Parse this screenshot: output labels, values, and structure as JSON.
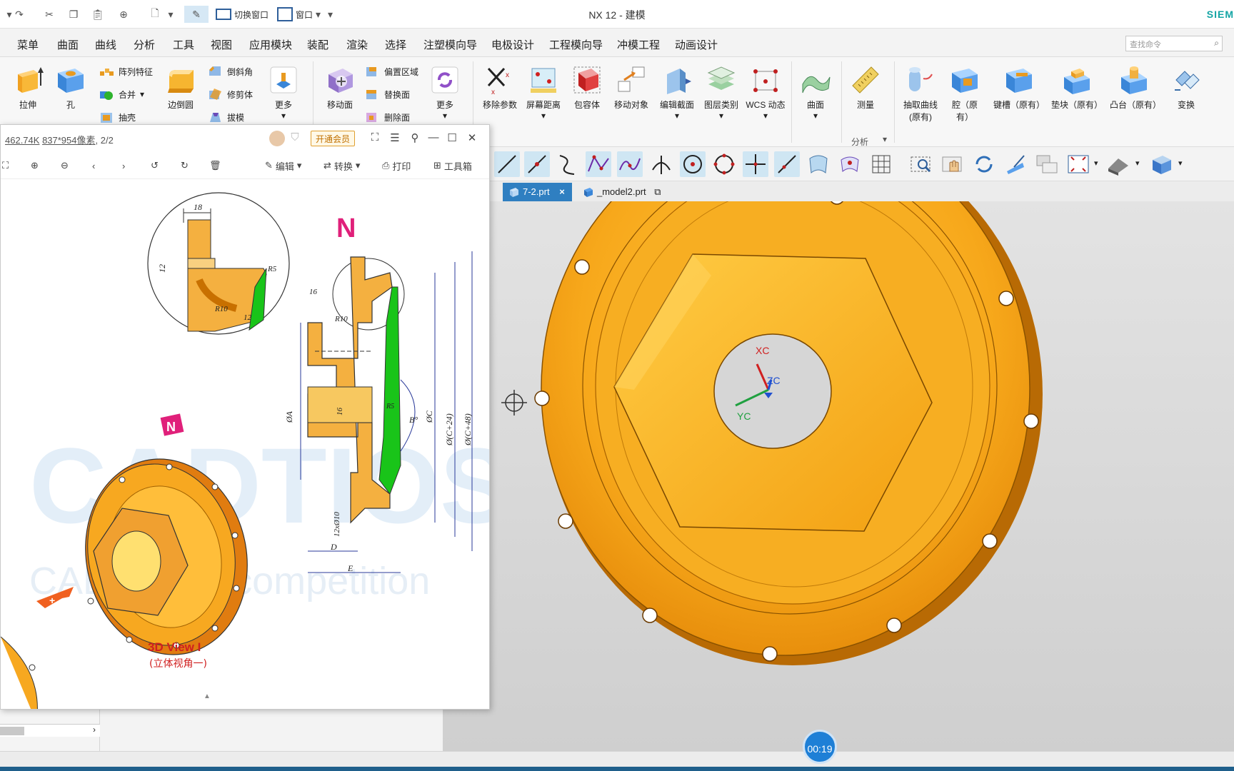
{
  "window": {
    "title": "NX 12 - 建模",
    "brand": "SIEM",
    "quick_access": {
      "switch_window": "切换窗口",
      "window": "窗口"
    }
  },
  "menu": {
    "items": [
      "菜单",
      "曲面",
      "曲线",
      "分析",
      "工具",
      "视图",
      "应用模块",
      "装配",
      "渲染",
      "选择",
      "注塑模向导",
      "电极设计",
      "工程模向导",
      "冲模工程",
      "动画设计"
    ],
    "search_placeholder": "查找命令"
  },
  "ribbon": {
    "extrude": "拉伸",
    "hole": "孔",
    "pattern_feature": "阵列特征",
    "unite": "合并",
    "shell": "抽壳",
    "edge_blend": "边倒圆",
    "chamfer": "倒斜角",
    "trim_body": "修剪体",
    "draft": "拔模",
    "more1": "更多",
    "move_face": "移动面",
    "offset_region": "偏置区域",
    "replace_face": "替换面",
    "delete_face": "删除面",
    "more2": "更多",
    "remove_params": "移除参数",
    "screen_distance": "屏幕距离",
    "bounding_body": "包容体",
    "move_object": "移动对象",
    "edit_section": "编辑截面",
    "layer_category": "图层类别",
    "wcs_dynamic": "WCS 动态",
    "surface": "曲面",
    "measure": "测量",
    "analysis_group": "分析",
    "extract_curve_line1": "抽取曲线",
    "extract_curve_line2": "(原有)",
    "cavity": "腔（原有）",
    "slot": "键槽（原有）",
    "pad": "垫块（原有）",
    "boss": "凸台（原有）",
    "transform": "变换"
  },
  "tabs": [
    {
      "label": "7-2.prt",
      "active": true,
      "close": "×"
    },
    {
      "label": "_model2.prt",
      "active": false
    }
  ],
  "viewer": {
    "file_size": "462.74K",
    "dimensions": "837*954像素",
    "page": ", 2/2",
    "vip": "开通会员",
    "toolbar": {
      "edit": "编辑",
      "convert": "转换",
      "print": "打印",
      "toolbox": "工具箱"
    },
    "drawing": {
      "marker": "N",
      "view_title": "3D View I",
      "view_subtitle": "(立体视角一)",
      "watermark_line1": "CADTIOS",
      "watermark_line2": "CAD digital competition",
      "dims": [
        "18",
        "12",
        "R5",
        "R10",
        "12",
        "16",
        "R10",
        "16",
        "ØA",
        "R5",
        "B°",
        "ØC",
        "Ø(C+24)",
        "Ø(C+48)",
        "12xØ10",
        "D",
        "E"
      ]
    }
  },
  "viewport": {
    "axes": {
      "x": "XC",
      "y": "YC",
      "z": "ZC"
    }
  },
  "timer": "00:19",
  "colors": {
    "part_orange": "#f7a81b",
    "accent_blue": "#2f7fc1",
    "section_green": "#19c419"
  }
}
